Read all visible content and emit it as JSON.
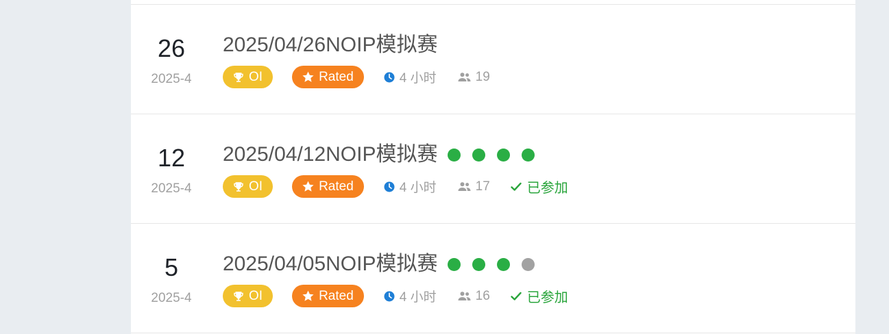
{
  "contests": [
    {
      "day": "26",
      "year_month": "2025-4",
      "title": "2025/04/26NOIP模拟赛",
      "rule_badge": "OI",
      "rated_badge": "Rated",
      "duration": "4 小时",
      "participants": "19",
      "joined": "",
      "problem_status": []
    },
    {
      "day": "12",
      "year_month": "2025-4",
      "title": "2025/04/12NOIP模拟赛",
      "rule_badge": "OI",
      "rated_badge": "Rated",
      "duration": "4 小时",
      "participants": "17",
      "joined": "已参加",
      "problem_status": [
        "#2aae45",
        "#2aae45",
        "#2aae45",
        "#2aae45"
      ]
    },
    {
      "day": "5",
      "year_month": "2025-4",
      "title": "2025/04/05NOIP模拟赛",
      "rule_badge": "OI",
      "rated_badge": "Rated",
      "duration": "4 小时",
      "participants": "16",
      "joined": "已参加",
      "problem_status": [
        "#2aae45",
        "#2aae45",
        "#2aae45",
        "#a2a2a2"
      ]
    }
  ],
  "colors": {
    "oi_badge": "#f2c12e",
    "rated_badge": "#f6821f",
    "clock_icon": "#1f7fd6",
    "joined_text": "#2aa53c",
    "solved_dot": "#2aae45",
    "unsolved_dot": "#a2a2a2"
  }
}
